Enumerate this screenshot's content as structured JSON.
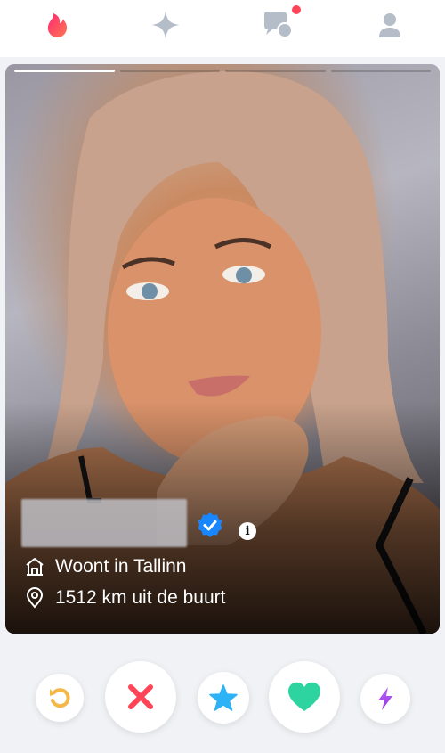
{
  "nav": {
    "items": [
      {
        "name": "flame-icon",
        "color": "#fe4a5b"
      },
      {
        "name": "sparkle-icon",
        "color": "#b5bdc8"
      },
      {
        "name": "chat-icon",
        "color": "#b5bdc8",
        "badge": true
      },
      {
        "name": "profile-icon",
        "color": "#b5bdc8"
      }
    ]
  },
  "card": {
    "photo_count": 4,
    "active_photo": 1,
    "verified": true,
    "location": "Woont in Tallinn",
    "distance": "1512 km uit de buurt",
    "info_glyph": "i"
  },
  "actions": [
    {
      "name": "rewind-button",
      "icon": "rewind-icon",
      "color": "#f5b748"
    },
    {
      "name": "nope-button",
      "icon": "x-icon",
      "color": "#ff4458"
    },
    {
      "name": "super-like-button",
      "icon": "star-icon",
      "color": "#2db2f5"
    },
    {
      "name": "like-button",
      "icon": "heart-icon",
      "color": "#2dd4a0"
    },
    {
      "name": "boost-button",
      "icon": "lightning-icon",
      "color": "#a445f2"
    }
  ]
}
